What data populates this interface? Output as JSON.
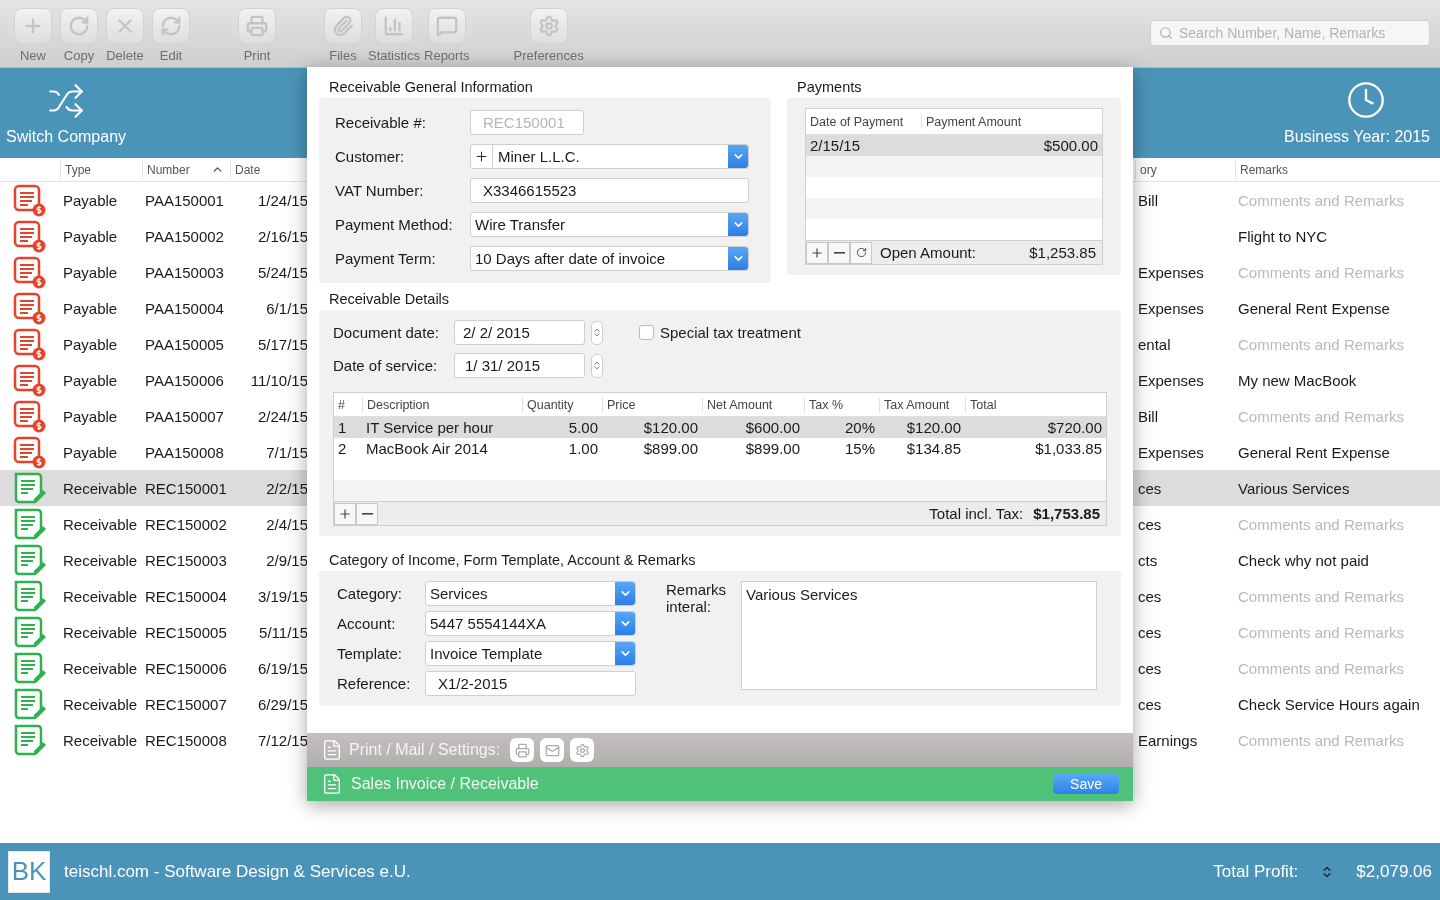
{
  "toolbar": {
    "buttons": [
      {
        "label": "New"
      },
      {
        "label": "Copy"
      },
      {
        "label": "Delete"
      },
      {
        "label": "Edit"
      },
      {
        "label": "Print"
      },
      {
        "label": "Files"
      },
      {
        "label": "Statistics"
      },
      {
        "label": "Reports"
      },
      {
        "label": "Preferences"
      }
    ],
    "search": {
      "placeholder": "Search Number, Name, Remarks"
    }
  },
  "header": {
    "switch_company": "Switch Company",
    "business_year": "Business Year: 2015"
  },
  "list": {
    "columns": [
      {
        "label": "Type",
        "sorted": false
      },
      {
        "label": "Number",
        "sorted": true
      },
      {
        "label": "Date",
        "sorted": false
      },
      {
        "label": "ory",
        "sorted": false
      },
      {
        "label": "Remarks",
        "sorted": false
      }
    ],
    "rows": [
      {
        "kind": "payable",
        "type": "Payable",
        "number": "PAA150001",
        "date": "1/24/15",
        "category": "Bill",
        "remarks": "Comments and Remarks",
        "placeholder": true,
        "selected": false
      },
      {
        "kind": "payable",
        "type": "Payable",
        "number": "PAA150002",
        "date": "2/16/15",
        "remarks": "Flight to NYC",
        "placeholder": false,
        "selected": false
      },
      {
        "kind": "payable",
        "type": "Payable",
        "number": "PAA150003",
        "date": "5/24/15",
        "category": "Expenses",
        "remarks": "Comments and Remarks",
        "placeholder": true,
        "selected": false
      },
      {
        "kind": "payable",
        "type": "Payable",
        "number": "PAA150004",
        "date": "6/1/15",
        "category": "Expenses",
        "remarks": "General Rent Expense",
        "placeholder": false,
        "selected": false
      },
      {
        "kind": "payable",
        "type": "Payable",
        "number": "PAA150005",
        "date": "5/17/15",
        "category": "ental",
        "remarks": "Comments and Remarks",
        "placeholder": true,
        "selected": false
      },
      {
        "kind": "payable",
        "type": "Payable",
        "number": "PAA150006",
        "date": "11/10/15",
        "category": "Expenses",
        "remarks": "My new MacBook",
        "placeholder": false,
        "selected": false
      },
      {
        "kind": "payable",
        "type": "Payable",
        "number": "PAA150007",
        "date": "2/24/15",
        "category": "Bill",
        "remarks": "Comments and Remarks",
        "placeholder": true,
        "selected": false
      },
      {
        "kind": "payable",
        "type": "Payable",
        "number": "PAA150008",
        "date": "7/1/15",
        "category": "Expenses",
        "remarks": "General Rent Expense",
        "placeholder": false,
        "selected": false
      },
      {
        "kind": "receivable",
        "type": "Receivable",
        "number": "REC150001",
        "date": "2/2/15",
        "category": "ces",
        "remarks": "Various Services",
        "placeholder": false,
        "selected": true
      },
      {
        "kind": "receivable",
        "type": "Receivable",
        "number": "REC150002",
        "date": "2/4/15",
        "category": "ces",
        "remarks": "Comments and Remarks",
        "placeholder": true,
        "selected": false
      },
      {
        "kind": "receivable",
        "type": "Receivable",
        "number": "REC150003",
        "date": "2/9/15",
        "category": "cts",
        "remarks": "Check why not paid",
        "placeholder": false,
        "selected": false
      },
      {
        "kind": "receivable",
        "type": "Receivable",
        "number": "REC150004",
        "date": "3/19/15",
        "category": "ces",
        "remarks": "Comments and Remarks",
        "placeholder": true,
        "selected": false
      },
      {
        "kind": "receivable",
        "type": "Receivable",
        "number": "REC150005",
        "date": "5/11/15",
        "category": "ces",
        "remarks": "Comments and Remarks",
        "placeholder": true,
        "selected": false
      },
      {
        "kind": "receivable",
        "type": "Receivable",
        "number": "REC150006",
        "date": "6/19/15",
        "category": "ces",
        "remarks": "Comments and Remarks",
        "placeholder": true,
        "selected": false
      },
      {
        "kind": "receivable",
        "type": "Receivable",
        "number": "REC150007",
        "date": "6/29/15",
        "category": "ces",
        "remarks": "Check Service Hours again",
        "placeholder": false,
        "selected": false
      },
      {
        "kind": "receivable",
        "type": "Receivable",
        "number": "REC150008",
        "date": "7/12/15",
        "category": "Earnings",
        "remarks": "Comments and Remarks",
        "placeholder": true,
        "selected": false
      }
    ]
  },
  "dialog": {
    "general": {
      "title": "Receivable General Information",
      "fields": [
        {
          "kind": "readonly",
          "label": "Receivable #:",
          "value": "REC150001"
        },
        {
          "kind": "combo",
          "label": "Customer:",
          "value": "Miner L.L.C."
        },
        {
          "kind": "text",
          "label": "VAT Number:",
          "value": "X3346615523"
        },
        {
          "kind": "select",
          "label": "Payment Method:",
          "value": "Wire Transfer"
        },
        {
          "kind": "select",
          "label": "Payment Term:",
          "value": "10 Days after date of invoice"
        }
      ]
    },
    "payments": {
      "title": "Payments",
      "columns": [
        "Date of Payment",
        "Payment Amount"
      ],
      "rows": [
        {
          "date": "2/15/15",
          "amount": "$500.00",
          "selected": true
        }
      ],
      "open_amount_label": "Open Amount:",
      "open_amount": "$1,253.85"
    },
    "details": {
      "title": "Receivable Details",
      "document_date_label": "Document date:",
      "document_date": "2/  2/ 2015",
      "service_date_label": "Date of service:",
      "service_date": "1/ 31/ 2015",
      "special_tax": {
        "label": "Special tax treatment",
        "checked": false
      },
      "columns": [
        "#",
        "Description",
        "Quantity",
        "Price",
        "Net Amount",
        "Tax %",
        "Tax Amount",
        "Total"
      ],
      "items": [
        {
          "cells": [
            "1",
            "IT Service per hour",
            "5.00",
            "$120.00",
            "$600.00",
            "20%",
            "$120.00",
            "$720.00"
          ],
          "selected": true
        },
        {
          "cells": [
            "2",
            "MacBook Air 2014",
            "1.00",
            "$899.00",
            "$899.00",
            "15%",
            "$134.85",
            "$1,033.85"
          ],
          "selected": false
        }
      ],
      "total_label": "Total incl. Tax:",
      "total": "$1,753.85"
    },
    "category": {
      "title": "Category of Income, Form Template, Account & Remarks",
      "fields": [
        {
          "kind": "select",
          "label": "Category:",
          "value": "Services"
        },
        {
          "kind": "select",
          "label": "Account:",
          "value": "5447 5554144XA"
        },
        {
          "kind": "select",
          "label": "Template:",
          "value": "Invoice Template"
        },
        {
          "kind": "text",
          "label": "Reference:",
          "value": "X1/2-2015"
        }
      ],
      "remarks_label": "Remarks\ninteral:",
      "remarks": "Various Services"
    },
    "print_bar": {
      "label": "Print / Mail / Settings:"
    },
    "footer": {
      "title": "Sales Invoice / Receivable",
      "save": "Save"
    }
  },
  "status_bar": {
    "logo": "BK",
    "company": "teischl.com - Software Design & Services e.U.",
    "profit_label": "Total Profit:",
    "profit": "$2,079.06"
  }
}
